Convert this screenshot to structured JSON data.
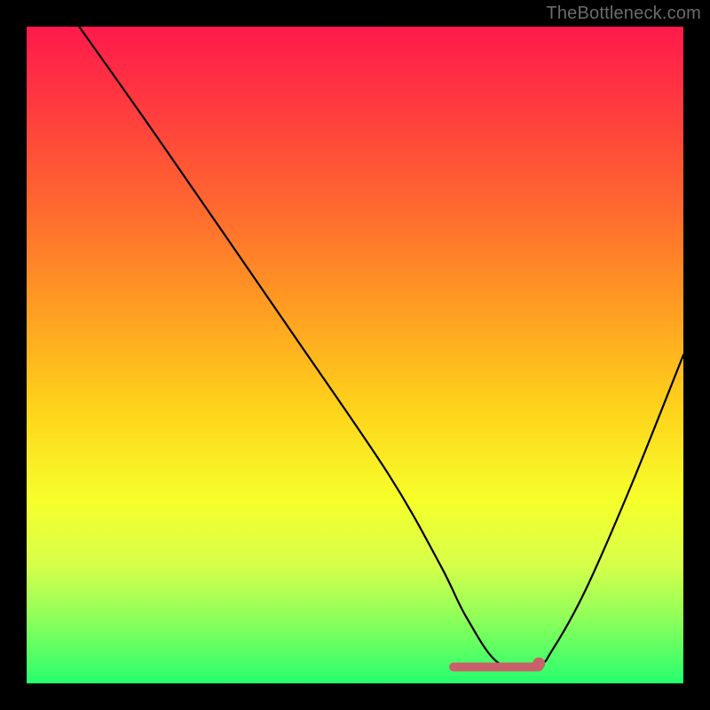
{
  "watermark": "TheBottleneck.com",
  "chart_data": {
    "type": "line",
    "title": "",
    "xlabel": "",
    "ylabel": "",
    "xlim": [
      0,
      100
    ],
    "ylim": [
      0,
      100
    ],
    "grid": false,
    "legend": false,
    "series": [
      {
        "name": "bottleneck-curve",
        "x": [
          8,
          20,
          40,
          55,
          63,
          67,
          72,
          78,
          80,
          85,
          92,
          100
        ],
        "y": [
          100,
          83,
          54,
          32,
          18,
          10,
          3,
          3,
          5,
          14,
          30,
          50
        ]
      }
    ],
    "markers": {
      "name": "optimal-range",
      "x_start": 65,
      "x_end": 78,
      "y": 2.5,
      "dot_x": 78,
      "dot_y": 3
    },
    "gradient_stops": [
      {
        "pos": 0,
        "color": "#ff1a4b"
      },
      {
        "pos": 12,
        "color": "#ff3a3f"
      },
      {
        "pos": 28,
        "color": "#ff6a2f"
      },
      {
        "pos": 42,
        "color": "#ff9a22"
      },
      {
        "pos": 58,
        "color": "#ffd21b"
      },
      {
        "pos": 72,
        "color": "#f6ff2a"
      },
      {
        "pos": 82,
        "color": "#d6ff4a"
      },
      {
        "pos": 90,
        "color": "#8fff5a"
      },
      {
        "pos": 100,
        "color": "#26ff6e"
      }
    ]
  }
}
